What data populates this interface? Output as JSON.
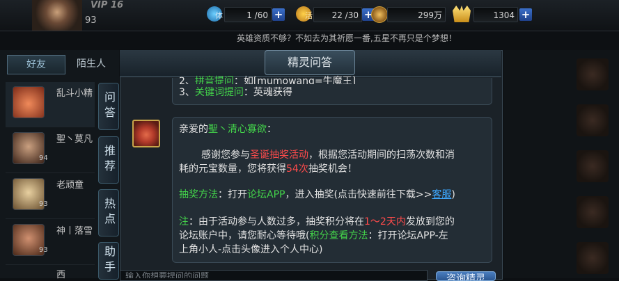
{
  "topbar": {
    "vip": "VIP 16",
    "level": "93",
    "stamina_label": "体",
    "stamina": "1 /60",
    "vitality_label": "活",
    "vitality": "22 /30",
    "coins": "299万",
    "gold": "1304"
  },
  "marquee": "英雄资质不够？不如去为其祈愿一番,五星不再只是个梦想！",
  "left_panel": {
    "tabs": [
      "好友",
      "陌生人"
    ],
    "friends": [
      {
        "name": "乱斗小精",
        "level": ""
      },
      {
        "name": "聖丶莫凡",
        "level": "94"
      },
      {
        "name": "老顽童",
        "level": "93"
      },
      {
        "name": "神丨落雪",
        "level": "93"
      },
      {
        "name": "西",
        "level": ""
      }
    ]
  },
  "side_tabs": [
    "问答",
    "推荐",
    "热点",
    "助手"
  ],
  "dialog": {
    "title": "精灵问答",
    "prev_lines": [
      "2、拼音提问：如[mumowang=牛魔王]",
      "3、关键词提问：英魂获得"
    ],
    "prev_line2_prefix": "2、",
    "prev_line2_green": "拼音提问",
    "prev_line2_rest": "：如[mumowang=牛魔王]",
    "prev_line3_prefix": "3、",
    "prev_line3_green": "关键词提问",
    "prev_line3_rest": "：英魂获得",
    "greeting_prefix": "亲爱的",
    "greeting_name": "聖丶清心寡欲",
    "greeting_suffix": "：",
    "p1_a": "感谢您参与",
    "p1_event": "圣诞抽奖活动",
    "p1_b": "，根据您活动期间的扫荡次数和消",
    "p1_c": "耗的元宝数量，您将获得",
    "p1_count": "54次",
    "p1_d": "抽奖机会！",
    "method_label": "抽奖方法",
    "method_a": "：打开",
    "method_app": "论坛APP",
    "method_b": "，进入抽奖(点击快速前往下载>>",
    "method_link": "客服",
    "method_c": ")",
    "note_label": "注",
    "note_a": "：由于活动参与人数过多，抽奖积分将在",
    "note_days": "1～2天内",
    "note_b": "发放到您的",
    "note_c": "论坛账户中，请您耐心等待哦(",
    "note_check": "积分查看方法",
    "note_d": "：打开论坛APP-左",
    "note_e": "上角小人-点击头像进入个人中心)",
    "input_placeholder": "输入你想要提问的问题",
    "send_label": "咨询精灵"
  },
  "colors": {
    "accent_green": "#43d34a",
    "accent_red": "#ff4b4b",
    "link_blue": "#3ea8ff"
  }
}
